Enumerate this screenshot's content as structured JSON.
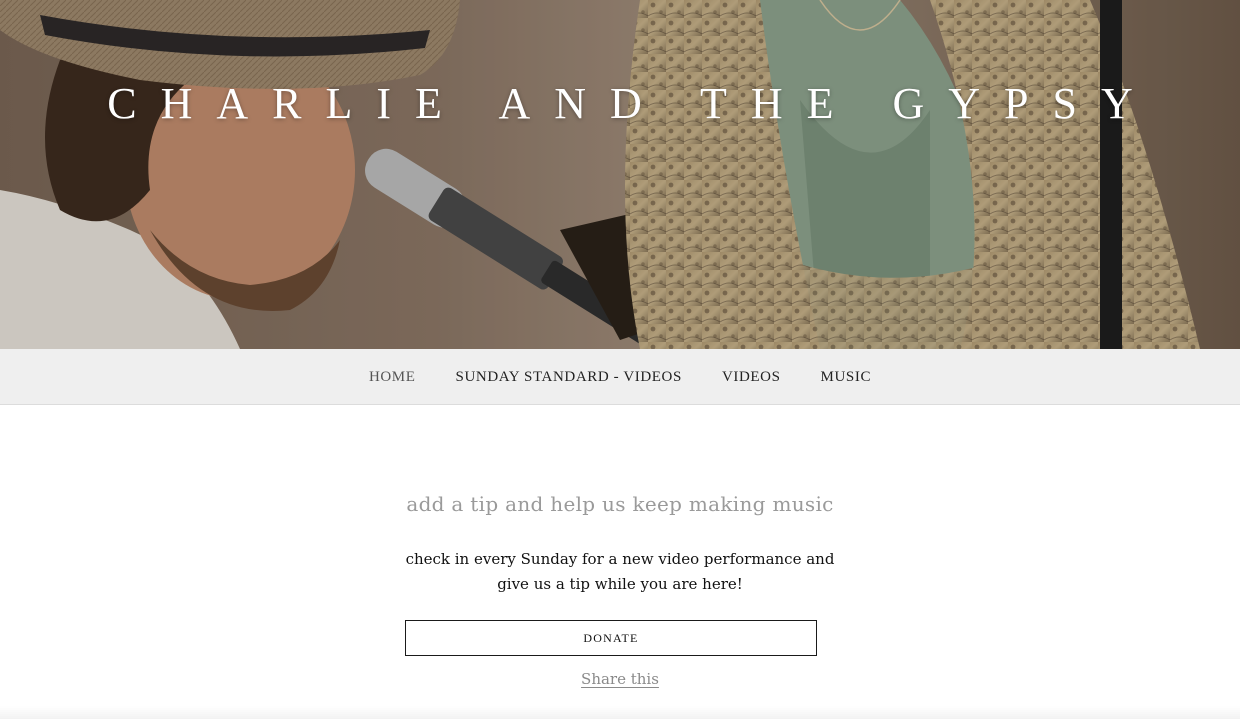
{
  "header": {
    "site_title": "CHARLIE AND THE GYPSY"
  },
  "nav": {
    "items": [
      {
        "label": "HOME",
        "active": true
      },
      {
        "label": "SUNDAY STANDARD - VIDEOS",
        "active": false
      },
      {
        "label": "VIDEOS",
        "active": false
      },
      {
        "label": "MUSIC",
        "active": false
      }
    ]
  },
  "main": {
    "tagline": "add a tip and help us keep making music",
    "body_line1": "check in every Sunday for a new video performance and",
    "body_line2": "give us a tip while you are here!",
    "donate_label": "DONATE",
    "share_label": "Share this"
  },
  "colors": {
    "nav_bg": "#efefef",
    "tagline": "#9a9a9a",
    "share_link": "#8a8a8a",
    "button_border": "#1a1a1a"
  }
}
